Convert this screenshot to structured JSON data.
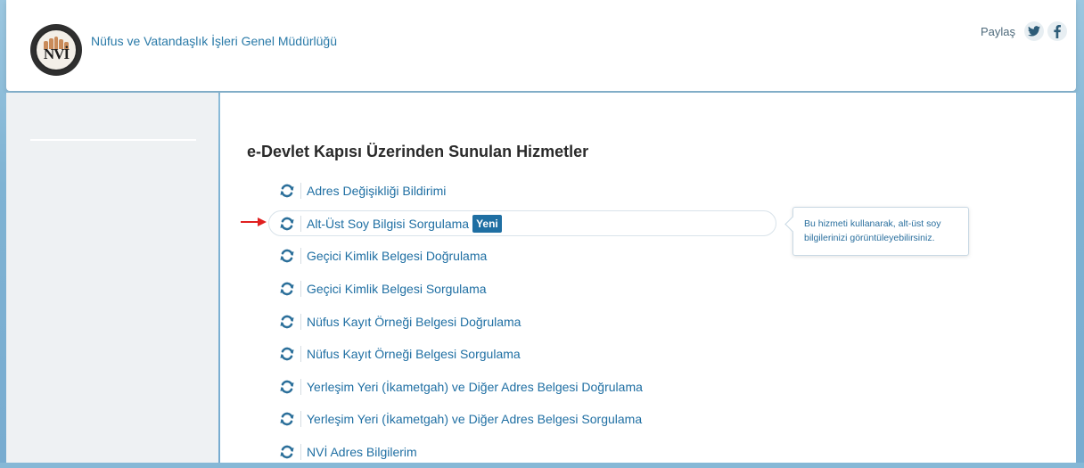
{
  "header": {
    "org_title": "Nüfus ve Vatandaşlık İşleri Genel Müdürlüğü",
    "logo_text": "NVİ",
    "share_label": "Paylaş",
    "social": [
      {
        "name": "twitter-icon",
        "glyph": "t"
      },
      {
        "name": "facebook-icon",
        "glyph": "f"
      }
    ]
  },
  "main": {
    "section_title": "e-Devlet Kapısı Üzerinden Sunulan Hizmetler",
    "services": [
      {
        "label": "Adres Değişikliği Bildirimi"
      },
      {
        "label": "Alt-Üst Soy Bilgisi Sorgulama",
        "badge": "Yeni",
        "highlighted": true
      },
      {
        "label": "Geçici Kimlik Belgesi Doğrulama"
      },
      {
        "label": "Geçici Kimlik Belgesi Sorgulama"
      },
      {
        "label": "Nüfus Kayıt Örneği Belgesi Doğrulama"
      },
      {
        "label": "Nüfus Kayıt Örneği Belgesi Sorgulama"
      },
      {
        "label": "Yerleşim Yeri (İkametgah) ve Diğer Adres Belgesi Doğrulama"
      },
      {
        "label": "Yerleşim Yeri (İkametgah) ve Diğer Adres Belgesi Sorgulama"
      },
      {
        "label": "NVİ Adres Bilgilerim"
      }
    ],
    "tooltip": "Bu hizmeti kullanarak, alt-üst soy bilgilerinizi görüntüleyebilirsiniz."
  },
  "colors": {
    "link": "#1f6fa3",
    "badge_bg": "#1f6fa3",
    "arrow": "#e02020",
    "refresh_icon": "#2b6f9a"
  },
  "icons": {
    "service": "refresh-icon",
    "pointer": "red-arrow-icon"
  }
}
